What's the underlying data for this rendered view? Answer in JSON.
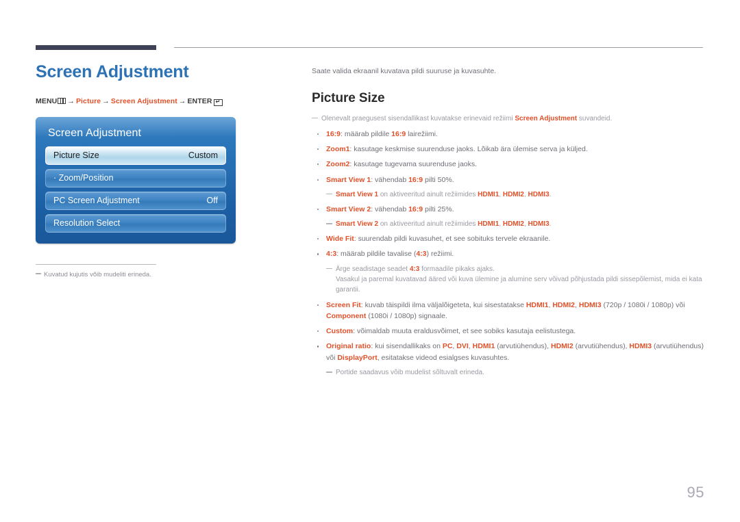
{
  "document": {
    "page_number": "95",
    "title": "Screen Adjustment",
    "accent_blue": "#2d72b4",
    "accent_orange": "#e1512a",
    "rule_dark": "#3f4257"
  },
  "breadcrumb": {
    "menu_label": "MENU",
    "menu_icon": "menu-grid-icon",
    "arrow": "→",
    "step1": "Picture",
    "step2": "Screen Adjustment",
    "enter_label": "ENTER",
    "enter_icon": "enter-return-icon",
    "enter_glyph": "↵"
  },
  "osd": {
    "title": "Screen Adjustment",
    "rows": [
      {
        "label": "Picture Size",
        "value": "Custom",
        "selected": true
      },
      {
        "label": "· Zoom/Position",
        "value": "",
        "selected": false
      },
      {
        "label": "PC Screen Adjustment",
        "value": "Off",
        "selected": false
      },
      {
        "label": "Resolution Select",
        "value": "",
        "selected": false
      }
    ]
  },
  "left_note": {
    "dash": "—",
    "text": "Kuvatud kujutis võib mudeliti erineda."
  },
  "right": {
    "intro": "Saate valida ekraanil kuvatava pildi suuruse ja kuvasuhte.",
    "section_title": "Picture Size",
    "top_note": {
      "before": "Olenevalt praegusest sisendallikast kuvatakse erinevaid režiimi ",
      "highlight": "Screen Adjustment",
      "after": " suvandeid."
    },
    "items": [
      {
        "kind": "bullet",
        "term": "16:9",
        "sep": ": ",
        "rest_before": "määrab pildile ",
        "rest_hi": "16:9",
        "rest_after": " lairežiimi."
      },
      {
        "kind": "bullet",
        "term": "Zoom1",
        "sep": ": ",
        "rest_before": "kasutage keskmise suurenduse jaoks. Lõikab ära ülemise serva ja küljed.",
        "rest_hi": "",
        "rest_after": ""
      },
      {
        "kind": "bullet",
        "term": "Zoom2",
        "sep": ": ",
        "rest_before": "kasutage tugevama suurenduse jaoks.",
        "rest_hi": "",
        "rest_after": ""
      },
      {
        "kind": "bullet",
        "term": "Smart View 1",
        "sep": ": ",
        "rest_before": "vähendab ",
        "rest_hi": "16:9",
        "rest_after": " pilti 50%."
      },
      {
        "kind": "note",
        "note_hi1": "Smart View 1",
        "note_mid": " on aktiveeritud ainult režiimides ",
        "note_hi2": "HDMI1",
        "note_sep1": ", ",
        "note_hi3": "HDMI2",
        "note_sep2": ", ",
        "note_hi4": "HDMI3",
        "note_end": "."
      },
      {
        "kind": "bullet",
        "term": "Smart View 2",
        "sep": ": ",
        "rest_before": "vähendab ",
        "rest_hi": "16:9",
        "rest_after": " pilti 25%."
      },
      {
        "kind": "note",
        "note_hi1": "Smart View 2",
        "note_mid": " on aktiveeritud ainult režiimides ",
        "note_hi2": "HDMI1",
        "note_sep1": ", ",
        "note_hi3": "HDMI2",
        "note_sep2": ", ",
        "note_hi4": "HDMI3",
        "note_end": "."
      },
      {
        "kind": "bullet",
        "term": "Wide Fit",
        "sep": ": ",
        "rest_before": "suurendab pildi kuvasuhet, et see sobituks tervele ekraanile.",
        "rest_hi": "",
        "rest_after": ""
      },
      {
        "kind": "bullet",
        "term": "4:3",
        "sep": ": ",
        "rest_before": "määrab pildile tavalise (",
        "rest_hi": "4:3",
        "rest_after": ") režiimi."
      },
      {
        "kind": "note2",
        "note_before": "Ärge seadistage seadet ",
        "note_hi": "4:3",
        "note_after": " formaadile pikaks ajaks.",
        "cont": "Vasakul ja paremal kuvatavad ääred või kuva ülemine ja alumine serv võivad põhjustada pildi sissepõlemist, mida ei kata garantii."
      },
      {
        "kind": "bullet_screenfit",
        "term": "Screen Fit",
        "sep": ": ",
        "p1": "kuvab täispildi ilma väljalõigeteta, kui sisestatakse ",
        "h1": "HDMI1",
        "s1": ", ",
        "h2": "HDMI2",
        "s2": ", ",
        "h3": "HDMI3",
        "p2": " (720p / 1080i / 1080p) või ",
        "h4": "Component",
        "p3": " (1080i / 1080p) signaale."
      },
      {
        "kind": "bullet",
        "term": "Custom",
        "sep": ": ",
        "rest_before": "võimaldab muuta eraldusvõimet, et see sobiks kasutaja eelistustega.",
        "rest_hi": "",
        "rest_after": ""
      },
      {
        "kind": "bullet_origratio",
        "term": "Original ratio",
        "sep": ": ",
        "p1": "kui sisendallikaks on ",
        "h1": "PC",
        "s1": ", ",
        "h2": "DVI",
        "s2": ", ",
        "h3": "HDMI1",
        "p2": " (arvutiühendus), ",
        "h4": "HDMI2",
        "p3": " (arvutiühendus), ",
        "h5": "HDMI3",
        "p4": " (arvutiühendus) või ",
        "h6": "DisplayPort",
        "p5": ", esitatakse videod esialgses kuvasuhtes."
      },
      {
        "kind": "note3",
        "text": "Portide saadavus võib mudelist sõltuvalt erineda."
      }
    ]
  }
}
